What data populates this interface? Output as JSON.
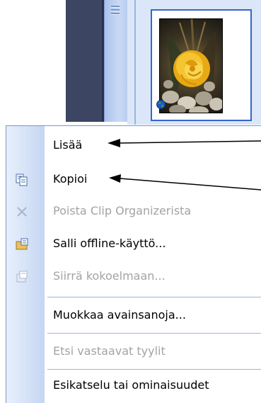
{
  "menu": {
    "items": [
      {
        "label": "Lisää",
        "disabled": false,
        "icon": ""
      },
      {
        "label": "Kopioi",
        "disabled": false,
        "icon": "copy-icon"
      },
      {
        "label": "Poista Clip Organizerista",
        "disabled": true,
        "icon": "delete-x-icon"
      },
      {
        "label": "Salli offline-käyttö...",
        "disabled": false,
        "icon": "offline-folder-icon"
      },
      {
        "label": "Siirrä kokoelmaan...",
        "disabled": true,
        "icon": "move-to-collection-icon"
      },
      {
        "label": "Muokkaa avainsanoja...",
        "disabled": false,
        "icon": ""
      },
      {
        "label": "Etsi vastaavat tyylit",
        "disabled": true,
        "icon": ""
      },
      {
        "label": "Esikatselu tai ominaisuudet",
        "disabled": false,
        "icon": ""
      }
    ]
  },
  "gallery": {
    "thumbnail": "yellow-rose-clip-image",
    "badge_icon": "globe-icon"
  },
  "colors": {
    "menu_gutter": "#c5d6f2",
    "selection_border": "#3566c9",
    "disabled_text": "#a3a3a3"
  }
}
